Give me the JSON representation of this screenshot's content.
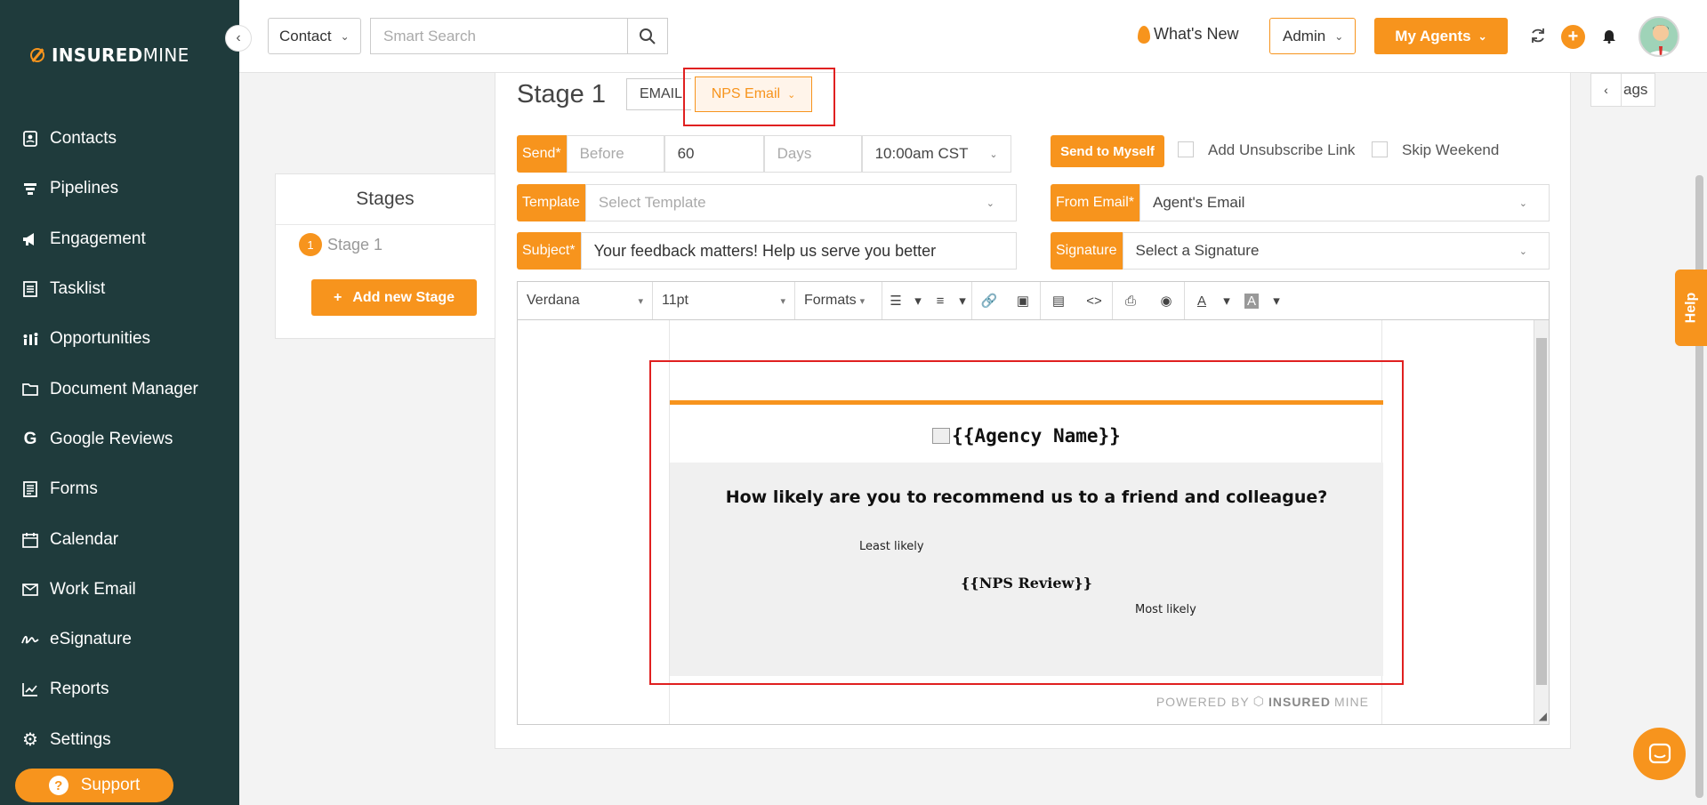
{
  "brand": {
    "name_bold": "INSURED",
    "name_light": "MINE",
    "accent_color": "#f7941d",
    "sidebar_color": "#1f3b3c"
  },
  "sidebar": {
    "items": [
      {
        "label": "Contacts",
        "icon": "contact-card-icon"
      },
      {
        "label": "Pipelines",
        "icon": "funnel-icon"
      },
      {
        "label": "Engagement",
        "icon": "megaphone-icon"
      },
      {
        "label": "Tasklist",
        "icon": "list-icon"
      },
      {
        "label": "Opportunities",
        "icon": "people-chart-icon"
      },
      {
        "label": "Document Manager",
        "icon": "folder-icon"
      },
      {
        "label": "Google Reviews",
        "icon": "google-icon"
      },
      {
        "label": "Forms",
        "icon": "form-icon"
      },
      {
        "label": "Calendar",
        "icon": "calendar-icon"
      },
      {
        "label": "Work Email",
        "icon": "envelope-icon"
      },
      {
        "label": "eSignature",
        "icon": "signature-icon"
      },
      {
        "label": "Reports",
        "icon": "line-chart-icon"
      },
      {
        "label": "Settings",
        "icon": "gear-icon"
      }
    ],
    "support_label": "Support"
  },
  "topbar": {
    "contact_select": "Contact",
    "search_placeholder": "Smart Search",
    "whats_new": "What's New",
    "admin_select": "Admin",
    "my_agents": "My Agents"
  },
  "stages": {
    "title": "Stages",
    "items": [
      {
        "number": "1",
        "label": "Stage 1"
      }
    ],
    "add_label": "Add new Stage"
  },
  "editor": {
    "stage_title": "Stage 1",
    "tab_email": "EMAIL",
    "tab_nps": "NPS Email",
    "send_label": "Send*",
    "send_when": "Before",
    "send_amount": "60",
    "send_unit": "Days",
    "send_time": "10:00am CST",
    "send_to_myself": "Send to Myself",
    "add_unsubscribe": "Add Unsubscribe Link",
    "skip_weekend": "Skip Weekend",
    "template_label": "Template",
    "template_placeholder": "Select Template",
    "from_email_label": "From Email*",
    "from_email_value": "Agent's Email",
    "subject_label": "Subject*",
    "subject_value": "Your feedback matters! Help us serve you better",
    "signature_label": "Signature",
    "signature_value": "Select a Signature",
    "toolbar": {
      "font": "Verdana",
      "size": "11pt",
      "formats": "Formats"
    }
  },
  "email_preview": {
    "agency_name": "{{Agency Name}}",
    "question": "How likely are you to recommend us to a friend and colleague?",
    "least_likely": "Least likely",
    "nps_review": "{{NPS Review}}",
    "most_likely": "Most likely",
    "powered_by": "POWERED BY",
    "powered_brand_bold": "INSURED",
    "powered_brand_light": "MINE"
  },
  "right_panel": {
    "tags_label": "ags",
    "help_label": "Help"
  }
}
